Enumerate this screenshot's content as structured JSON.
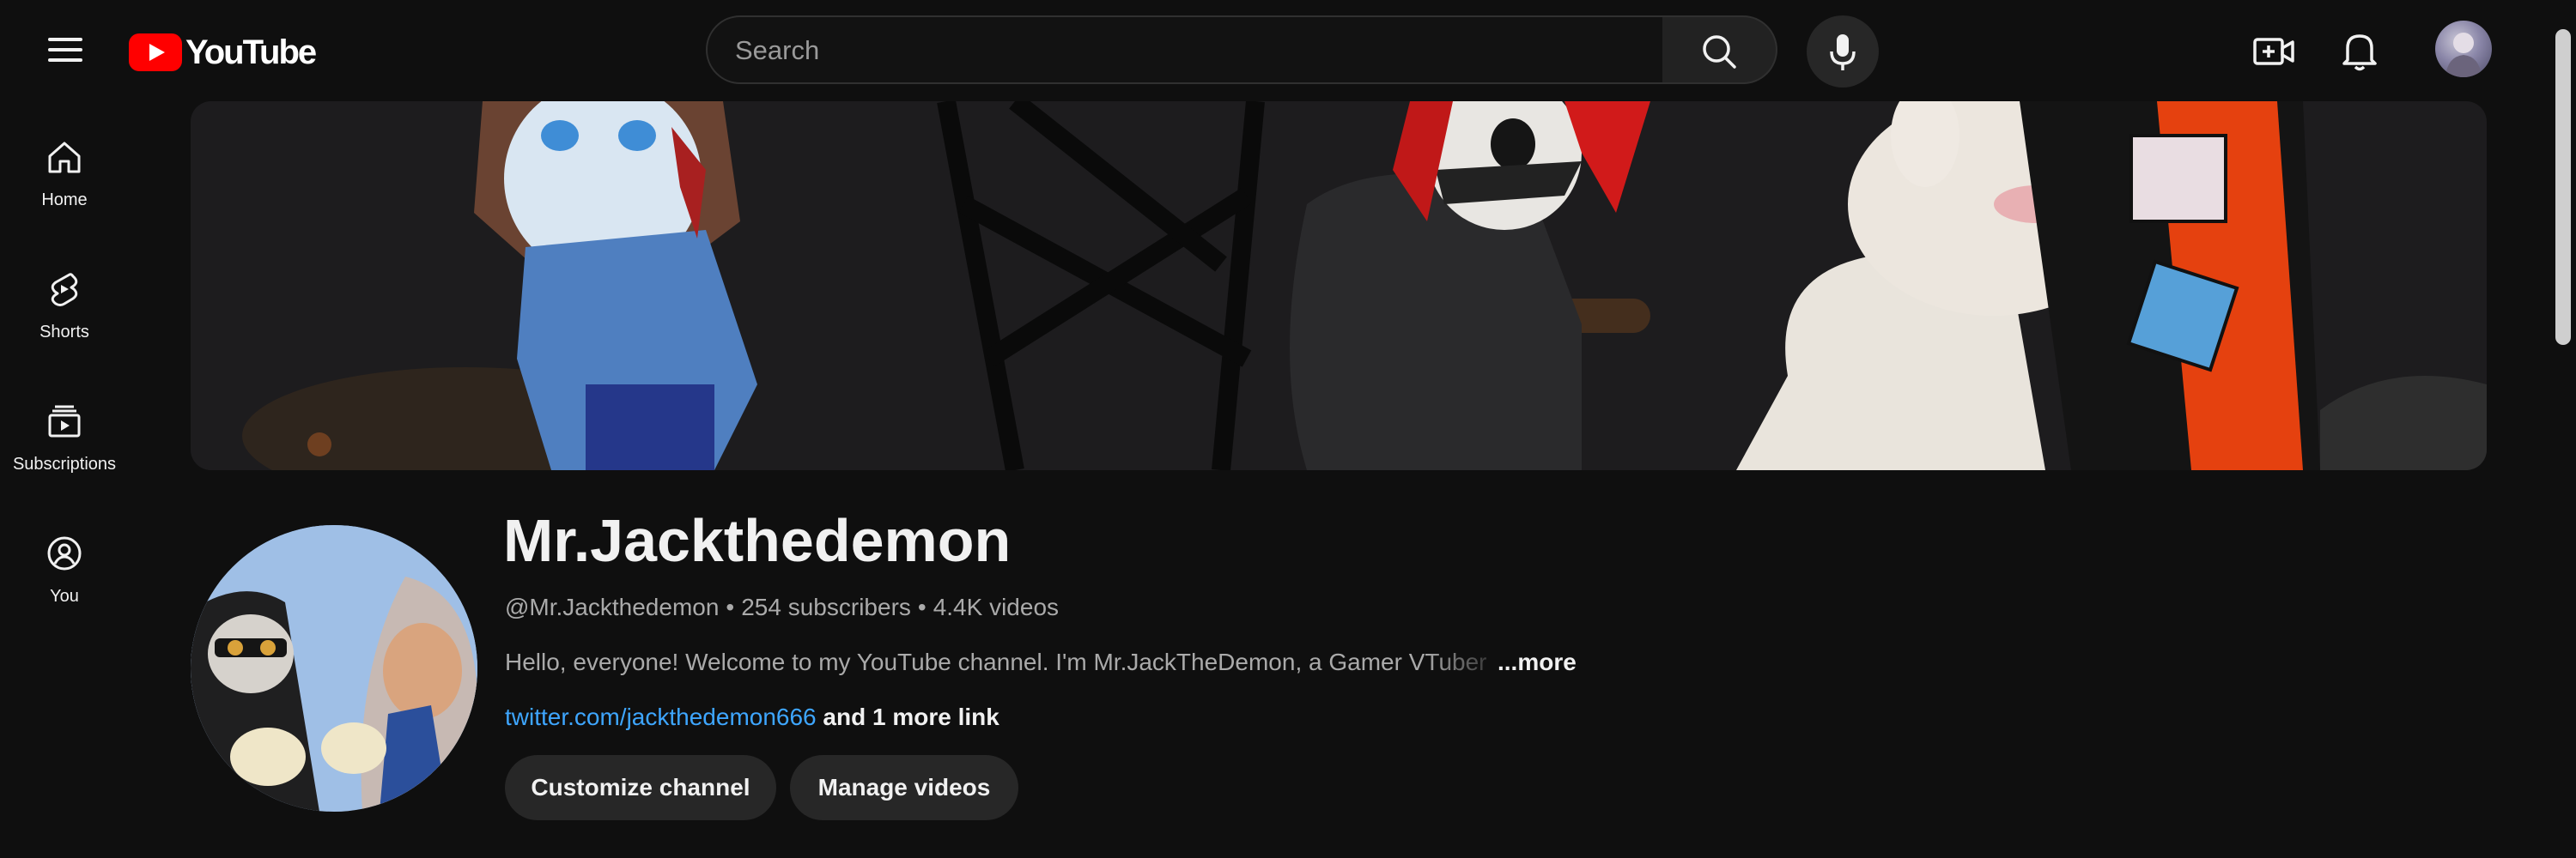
{
  "header": {
    "logo_text": "YouTube",
    "search_placeholder": "Search",
    "icons": {
      "menu": "hamburger-menu-icon",
      "search": "search-icon",
      "mic": "microphone-icon",
      "create": "video-create-icon",
      "notifications": "bell-icon"
    }
  },
  "sidebar": {
    "items": [
      {
        "label": "Home",
        "icon": "home-icon"
      },
      {
        "label": "Shorts",
        "icon": "shorts-icon"
      },
      {
        "label": "Subscriptions",
        "icon": "subscriptions-icon"
      },
      {
        "label": "You",
        "icon": "you-icon"
      }
    ]
  },
  "channel": {
    "name": "Mr.Jackthedemon",
    "handle": "@Mr.Jackthedemon",
    "subscribers": "254 subscribers",
    "videos": "4.4K videos",
    "separator": "•",
    "description": "Hello, everyone! Welcome to my YouTube channel. I'm Mr.JackTheDemon, a Gamer VTuber",
    "more_label": "...more",
    "link_text": "twitter.com/jackthedemon666",
    "more_links": "and 1 more link",
    "buttons": {
      "customize": "Customize channel",
      "manage": "Manage videos"
    }
  },
  "colors": {
    "background": "#0f0f0f",
    "brand_red": "#ff0000",
    "link_blue": "#3ea6ff",
    "button_bg": "#272727",
    "muted_text": "#aaaaaa"
  }
}
